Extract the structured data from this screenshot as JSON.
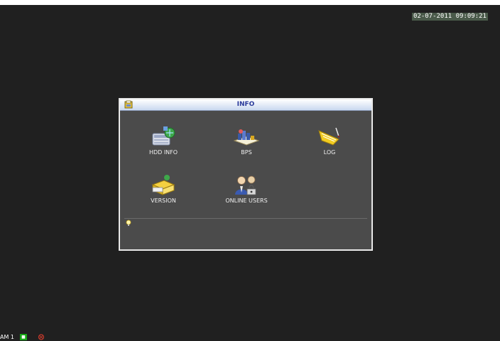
{
  "osd": {
    "datetime": "02-07-2011 09:09:21",
    "channel_label": "AM 1"
  },
  "dialog": {
    "title": "INFO",
    "items": [
      {
        "label": "HDD INFO",
        "icon": "hdd-icon"
      },
      {
        "label": "BPS",
        "icon": "bps-icon"
      },
      {
        "label": "LOG",
        "icon": "log-icon"
      },
      {
        "label": "VERSION",
        "icon": "version-icon"
      },
      {
        "label": "ONLINE USERS",
        "icon": "online-users-icon"
      }
    ]
  },
  "colors": {
    "background": "#202020",
    "panel": "#4b4b4b",
    "title_bar": "#c9d8ef",
    "title_text": "#2a3a9a",
    "clock_bg": "#4a5a4a",
    "record_indicator": "#17a617",
    "alarm_indicator": "#c0392b"
  }
}
